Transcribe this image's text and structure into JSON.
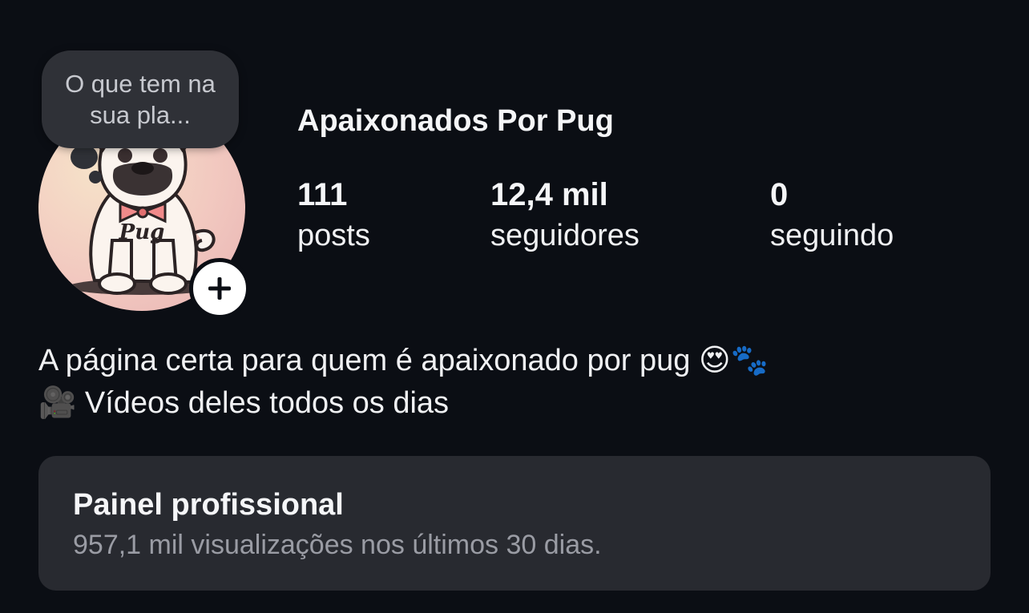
{
  "note": {
    "text": "O que tem na sua pla..."
  },
  "profile": {
    "name": "Apaixonados Por Pug",
    "avatar_icon": "pug-illustration-icon",
    "avatar_label": "Pug",
    "add_icon": "plus-icon"
  },
  "stats": [
    {
      "value": "111",
      "label": "posts"
    },
    {
      "value": "12,4 mil",
      "label": "seguidores"
    },
    {
      "value": "0",
      "label": "seguindo"
    }
  ],
  "bio": {
    "line1": "A página certa para quem é apaixonado por pug 😍🐾",
    "line2": "🎥 Vídeos deles todos os dias"
  },
  "professional_dashboard": {
    "title": "Painel profissional",
    "subtitle": "957,1 mil visualizações nos últimos 30 dias."
  },
  "colors": {
    "background": "#0b0e14",
    "panel": "#282a30",
    "bubble": "#2f3137",
    "muted_text": "#9a9ca4"
  }
}
